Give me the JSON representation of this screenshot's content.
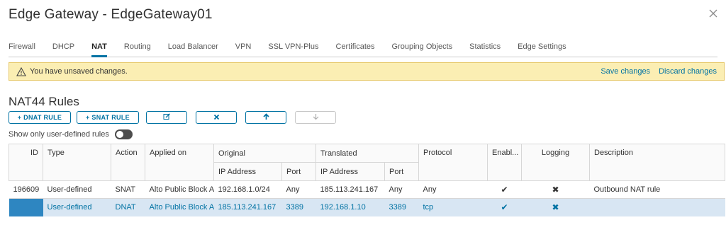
{
  "window": {
    "title": "Edge Gateway - EdgeGateway01",
    "close_icon": "close-icon"
  },
  "tabs": [
    {
      "label": "Firewall",
      "active": false
    },
    {
      "label": "DHCP",
      "active": false
    },
    {
      "label": "NAT",
      "active": true
    },
    {
      "label": "Routing",
      "active": false
    },
    {
      "label": "Load Balancer",
      "active": false
    },
    {
      "label": "VPN",
      "active": false
    },
    {
      "label": "SSL VPN-Plus",
      "active": false
    },
    {
      "label": "Certificates",
      "active": false
    },
    {
      "label": "Grouping Objects",
      "active": false
    },
    {
      "label": "Statistics",
      "active": false
    },
    {
      "label": "Edge Settings",
      "active": false
    }
  ],
  "banner": {
    "message": "You have unsaved changes.",
    "save_label": "Save changes",
    "discard_label": "Discard changes",
    "icon": "warning-icon",
    "bg_color": "#fbeeb3"
  },
  "section": {
    "title": "NAT44 Rules"
  },
  "toolbar": {
    "dnat_label": "+ DNAT RULE",
    "snat_label": "+ SNAT RULE",
    "edit_icon": "edit-icon",
    "delete_icon": "delete-icon",
    "move_up_icon": "arrow-up-icon",
    "move_down_icon": "arrow-down-icon"
  },
  "filter": {
    "label": "Show only user-defined rules",
    "enabled": false
  },
  "table": {
    "headers": {
      "id": "ID",
      "type": "Type",
      "action": "Action",
      "applied_on": "Applied on",
      "original": "Original",
      "translated": "Translated",
      "protocol": "Protocol",
      "enabled": "Enabl...",
      "logging": "Logging",
      "description": "Description",
      "ip_address": "IP Address",
      "port": "Port"
    },
    "rows": [
      {
        "id": "196609",
        "type": "User-defined",
        "action": "SNAT",
        "applied_on": "Alto Public Block A",
        "orig_ip": "192.168.1.0/24",
        "orig_port": "Any",
        "trans_ip": "185.113.241.167",
        "trans_port": "Any",
        "protocol": "Any",
        "enabled": "✔",
        "logging": "✖",
        "description": "Outbound NAT rule",
        "selected": false
      },
      {
        "id": "",
        "type": "User-defined",
        "action": "DNAT",
        "applied_on": "Alto Public Block A",
        "orig_ip": "185.113.241.167",
        "orig_port": "3389",
        "trans_ip": "192.168.1.10",
        "trans_port": "3389",
        "protocol": "tcp",
        "enabled": "✔",
        "logging": "✖",
        "description": "",
        "selected": true
      }
    ]
  },
  "colors": {
    "accent": "#0072a3",
    "selected_row": "#d8e6f3"
  }
}
